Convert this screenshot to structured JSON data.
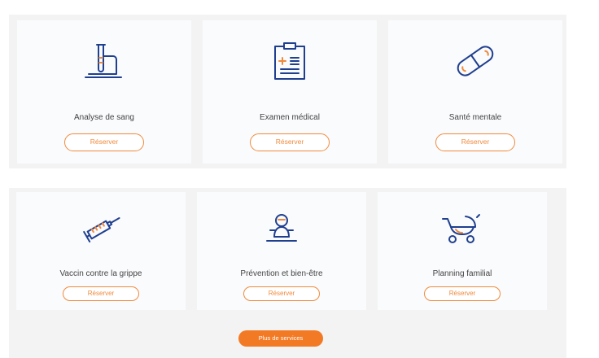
{
  "services_top": [
    {
      "title": "Analyse de sang",
      "button": "Réserver",
      "icon": "test-tube-icon"
    },
    {
      "title": "Examen médical",
      "button": "Réserver",
      "icon": "clipboard-icon"
    },
    {
      "title": "Santé mentale",
      "button": "Réserver",
      "icon": "pill-icon"
    }
  ],
  "services_bottom": [
    {
      "title": "Vaccin contre la grippe",
      "button": "Réserver",
      "icon": "syringe-icon"
    },
    {
      "title": "Prévention et bien-être",
      "button": "Réserver",
      "icon": "wellness-person-icon"
    },
    {
      "title": "Planning familial",
      "button": "Réserver",
      "icon": "baby-stroller-icon"
    }
  ],
  "more_services_label": "Plus de services",
  "colors": {
    "icon_blue": "#1f3f8f",
    "accent_orange": "#f08a3c",
    "button_fill": "#f37a25"
  }
}
